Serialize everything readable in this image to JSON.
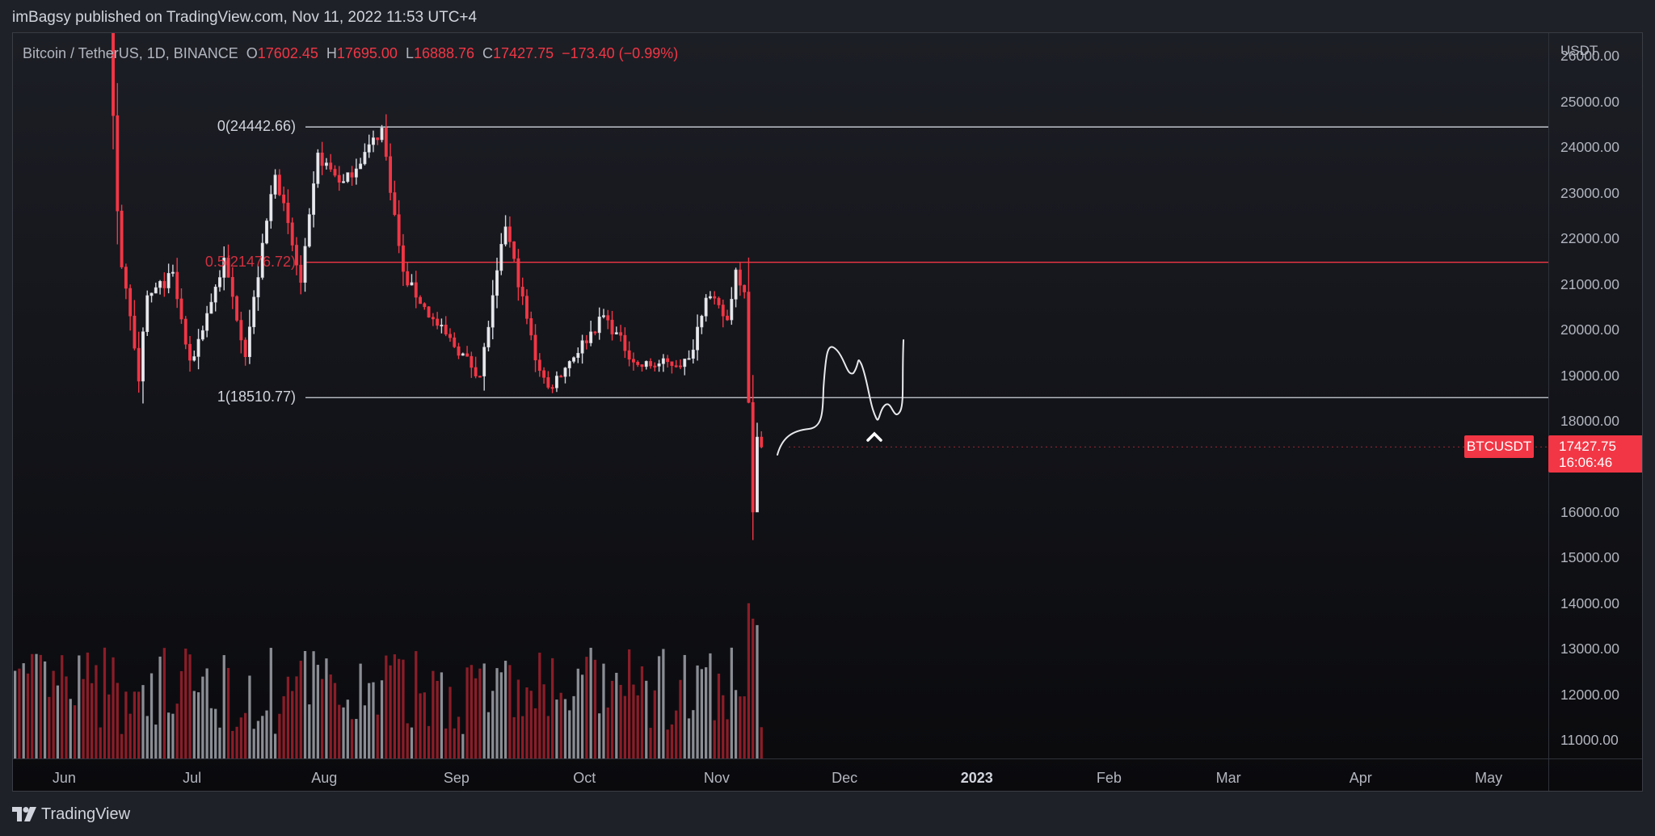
{
  "header": {
    "publish_info": "imBagsy published on TradingView.com, Nov 11, 2022 11:53 UTC+4"
  },
  "legend": {
    "symbol": "Bitcoin / TetherUS, 1D, BINANCE",
    "open_label": "O",
    "open": "17602.45",
    "high_label": "H",
    "high": "17695.00",
    "low_label": "L",
    "low": "16888.76",
    "close_label": "C",
    "close": "17427.75",
    "change": "−173.40 (−0.99%)"
  },
  "price_axis": {
    "unit": "USDT",
    "ticks": [
      "26000.00",
      "25000.00",
      "24000.00",
      "23000.00",
      "22000.00",
      "21000.00",
      "20000.00",
      "19000.00",
      "18000.00",
      "16000.00",
      "15000.00",
      "14000.00",
      "13000.00",
      "12000.00",
      "11000.00"
    ]
  },
  "time_axis": {
    "ticks": [
      {
        "label": "Jun",
        "year": false
      },
      {
        "label": "Jul",
        "year": false
      },
      {
        "label": "Aug",
        "year": false
      },
      {
        "label": "Sep",
        "year": false
      },
      {
        "label": "Oct",
        "year": false
      },
      {
        "label": "Nov",
        "year": false
      },
      {
        "label": "Dec",
        "year": false
      },
      {
        "label": "2023",
        "year": true
      },
      {
        "label": "Feb",
        "year": false
      },
      {
        "label": "Mar",
        "year": false
      },
      {
        "label": "Apr",
        "year": false
      },
      {
        "label": "May",
        "year": false
      }
    ]
  },
  "fib": {
    "top_label": "0(24442.66)",
    "mid_label": "0.5(21476.72)",
    "bottom_label": "1(18510.77)",
    "top_price": 24442.66,
    "mid_price": 21476.72,
    "bottom_price": 18510.77
  },
  "current_price": {
    "symbol": "BTCUSDT",
    "price": "17427.75",
    "countdown": "16:06:46"
  },
  "colors": {
    "up": "#d1d4dc",
    "down": "#f23645",
    "vol_up": "#8a8d94",
    "vol_down": "#8b1d28",
    "fib_line": "#d1d4dc",
    "fib_mid": "#f23645"
  },
  "footer": {
    "brand": "TradingView"
  },
  "chart_data": {
    "type": "candlestick",
    "symbol": "BTCUSDT",
    "interval": "1D",
    "x_range": [
      "2022-05-20",
      "2023-05-15"
    ],
    "y_range": [
      10600,
      26500
    ],
    "anchors": [
      {
        "date": "2022-06-05",
        "price": 30000
      },
      {
        "date": "2022-06-10",
        "price": 29000
      },
      {
        "date": "2022-06-13",
        "price": 22500
      },
      {
        "date": "2022-06-14",
        "price": 21500
      },
      {
        "date": "2022-06-18",
        "price": 19000
      },
      {
        "date": "2022-06-20",
        "price": 20700
      },
      {
        "date": "2022-06-26",
        "price": 21200
      },
      {
        "date": "2022-06-30",
        "price": 19200
      },
      {
        "date": "2022-07-08",
        "price": 21500
      },
      {
        "date": "2022-07-13",
        "price": 19500
      },
      {
        "date": "2022-07-20",
        "price": 23500
      },
      {
        "date": "2022-07-26",
        "price": 21000
      },
      {
        "date": "2022-07-30",
        "price": 23800
      },
      {
        "date": "2022-08-05",
        "price": 23200
      },
      {
        "date": "2022-08-14",
        "price": 24400
      },
      {
        "date": "2022-08-19",
        "price": 21200
      },
      {
        "date": "2022-08-26",
        "price": 20200
      },
      {
        "date": "2022-09-06",
        "price": 19000
      },
      {
        "date": "2022-09-12",
        "price": 22300
      },
      {
        "date": "2022-09-19",
        "price": 19400
      },
      {
        "date": "2022-09-22",
        "price": 18700
      },
      {
        "date": "2022-10-05",
        "price": 20300
      },
      {
        "date": "2022-10-13",
        "price": 19200
      },
      {
        "date": "2022-10-25",
        "price": 19300
      },
      {
        "date": "2022-10-29",
        "price": 20800
      },
      {
        "date": "2022-11-03",
        "price": 20200
      },
      {
        "date": "2022-11-05",
        "price": 21300
      },
      {
        "date": "2022-11-07",
        "price": 20900
      },
      {
        "date": "2022-11-08",
        "price": 18500
      },
      {
        "date": "2022-11-09",
        "price": 15900
      },
      {
        "date": "2022-11-10",
        "price": 17600
      },
      {
        "date": "2022-11-11",
        "price": 17427.75
      }
    ]
  }
}
